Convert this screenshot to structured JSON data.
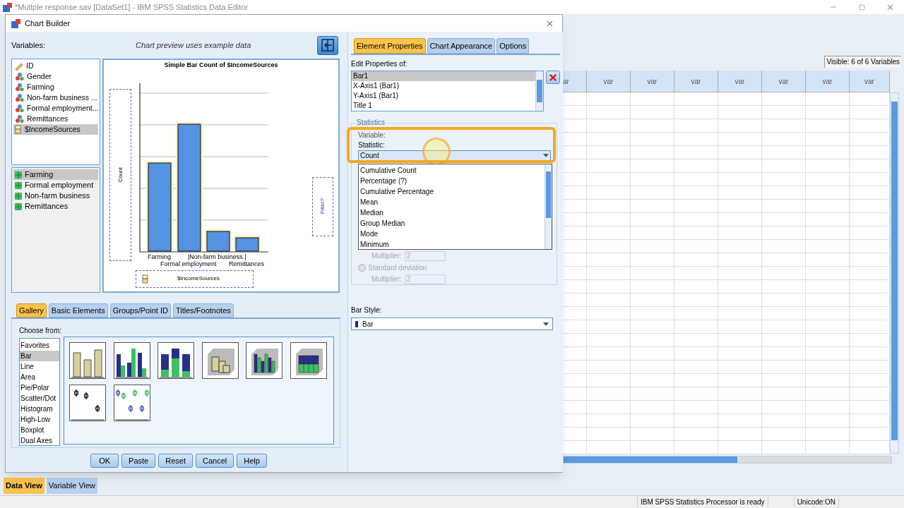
{
  "editor": {
    "title": "*Multple response.sav [DataSet1] - IBM SPSS Statistics Data Editor",
    "visible_label": "Visible: 6 of 6 Variables",
    "columns": [
      "ar",
      "var",
      "var",
      "var",
      "var",
      "var",
      "var",
      "var"
    ],
    "view_tabs": [
      {
        "label": "Data View",
        "selected": true
      },
      {
        "label": "Variable View",
        "selected": false
      }
    ],
    "status": [
      "IBM SPSS Statistics Processor is ready",
      "Unicode:ON"
    ]
  },
  "dialog": {
    "title": "Chart Builder",
    "variables_label": "Variables:",
    "preview_note": "Chart preview uses example data",
    "variables": [
      {
        "name": "ID",
        "kind": "scale",
        "selected": false
      },
      {
        "name": "Gender",
        "kind": "nominal",
        "selected": false
      },
      {
        "name": "Farming",
        "kind": "nominal",
        "selected": false
      },
      {
        "name": "Non-farm business ...",
        "kind": "nominal",
        "selected": false
      },
      {
        "name": "Formal employment...",
        "kind": "nominal",
        "selected": false
      },
      {
        "name": "Remittances",
        "kind": "nominal",
        "selected": false
      },
      {
        "name": "$IncomeSources",
        "kind": "set",
        "selected": true
      }
    ],
    "set_items": [
      {
        "name": "Farming",
        "selected": true
      },
      {
        "name": "Formal employment",
        "selected": false
      },
      {
        "name": "Non-farm business",
        "selected": false
      },
      {
        "name": "Remittances",
        "selected": false
      }
    ],
    "chart_preview": {
      "title": "Simple Bar Count of $IncomeSources",
      "y_zone": "Count",
      "filter_zone": "Filter?",
      "x_zone": "$IncomeSources",
      "category_labels": [
        "Farming",
        "Formal employment",
        "|Non-farm business |",
        "Remittances"
      ]
    },
    "property_tabs": [
      {
        "label": "Element Properties",
        "selected": true
      },
      {
        "label": "Chart Appearance",
        "selected": false
      },
      {
        "label": "Options",
        "selected": false
      }
    ],
    "edit_properties_label": "Edit Properties of:",
    "elements": [
      {
        "label": "Bar1",
        "selected": true
      },
      {
        "label": "X-Axis1 (Bar1)",
        "selected": false
      },
      {
        "label": "Y-Axis1 (Bar1)",
        "selected": false
      },
      {
        "label": "Title 1",
        "selected": false
      }
    ],
    "statistics": {
      "legend": "Statistics",
      "variable_label": "Variable:",
      "statistic_label": "Statistic:",
      "value": "Count",
      "options": [
        "Cumulative Count",
        "Percentage (?)",
        "Cumulative Percentage",
        "Mean",
        "Median",
        "Group Median",
        "Mode",
        "Minimum"
      ],
      "multiplier_label": "Multiplier:",
      "multiplier_value": "2",
      "std_dev": {
        "label": "Standard deviation",
        "selected": false,
        "disabled": true
      },
      "multiplier2_label": "Multiplier:",
      "multiplier2_value": "2"
    },
    "bar_style_label": "Bar Style:",
    "bar_style_value": "Bar",
    "gallery_tabs": [
      {
        "label": "Gallery",
        "selected": true
      },
      {
        "label": "Basic Elements",
        "selected": false
      },
      {
        "label": "Groups/Point ID",
        "selected": false
      },
      {
        "label": "Titles/Footnotes",
        "selected": false
      }
    ],
    "choose_from_label": "Choose from:",
    "chart_types": [
      {
        "label": "Favorites",
        "selected": false
      },
      {
        "label": "Bar",
        "selected": true
      },
      {
        "label": "Line",
        "selected": false
      },
      {
        "label": "Area",
        "selected": false
      },
      {
        "label": "Pie/Polar",
        "selected": false
      },
      {
        "label": "Scatter/Dot",
        "selected": false
      },
      {
        "label": "Histogram",
        "selected": false
      },
      {
        "label": "High-Low",
        "selected": false
      },
      {
        "label": "Boxplot",
        "selected": false
      },
      {
        "label": "Dual Axes",
        "selected": false
      }
    ],
    "thumbnails": [
      {
        "kind": "simple"
      },
      {
        "kind": "clustered"
      },
      {
        "kind": "stacked"
      },
      {
        "kind": "simple3d"
      },
      {
        "kind": "clustered3d"
      },
      {
        "kind": "stacked3d"
      },
      {
        "kind": "errorbar"
      },
      {
        "kind": "errorbar-clustered"
      }
    ],
    "buttons": [
      "OK",
      "Paste",
      "Reset",
      "Cancel",
      "Help"
    ]
  }
}
